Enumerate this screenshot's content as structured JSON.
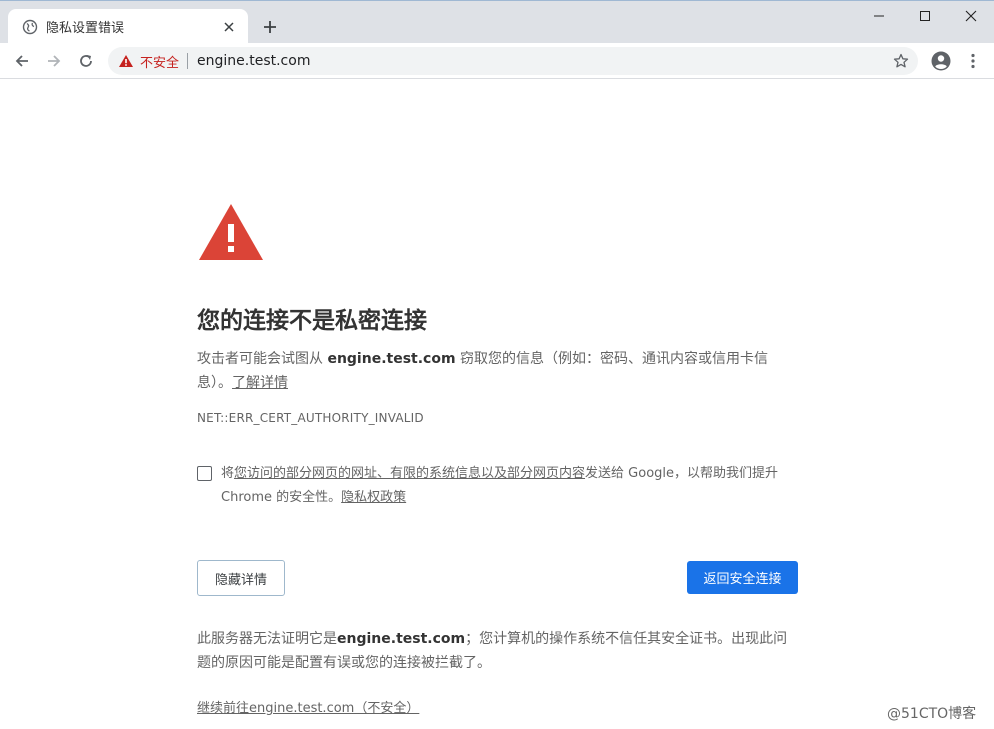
{
  "tab": {
    "title": "隐私设置错误",
    "new_tab_symbol": "+"
  },
  "omnibox": {
    "security_label": "不安全",
    "url": "engine.test.com"
  },
  "page": {
    "heading": "您的连接不是私密连接",
    "para_prefix": "攻击者可能会试图从 ",
    "para_host": "engine.test.com",
    "para_suffix": " 窃取您的信息（例如：密码、通讯内容或信用卡信息）。",
    "learn_more": "了解详情",
    "error_code": "NET::ERR_CERT_AUTHORITY_INVALID",
    "checkbox_prefix": "将",
    "checkbox_link": "您访问的部分网页的网址、有限的系统信息以及部分网页内容",
    "checkbox_suffix": "发送给 Google，以帮助我们提升 Chrome 的安全性。",
    "privacy_policy": "隐私权政策",
    "hide_details_button": "隐藏详情",
    "back_to_safety_button": "返回安全连接",
    "details_prefix": "此服务器无法证明它是",
    "details_host": "engine.test.com",
    "details_suffix": "；您计算机的操作系统不信任其安全证书。出现此问题的原因可能是配置有误或您的连接被拦截了。",
    "proceed_link": "继续前往engine.test.com（不安全）"
  },
  "watermark": "@51CTO博客",
  "icons": {
    "tab_favicon": "globe-icon",
    "tab_close": "close-icon",
    "minimize": "minimize-icon",
    "maximize": "maximize-icon",
    "close_window": "close-window-icon",
    "back": "back-arrow-icon",
    "forward": "forward-arrow-icon",
    "reload": "reload-icon",
    "omnibox_warning": "warning-triangle-icon",
    "bookmark": "star-icon",
    "profile": "profile-icon",
    "menu": "kebab-menu-icon",
    "page_warning": "warning-triangle-icon"
  },
  "colors": {
    "warning_red": "#db4437",
    "insecure_text": "#c5221f",
    "primary_button": "#1a73e8"
  }
}
